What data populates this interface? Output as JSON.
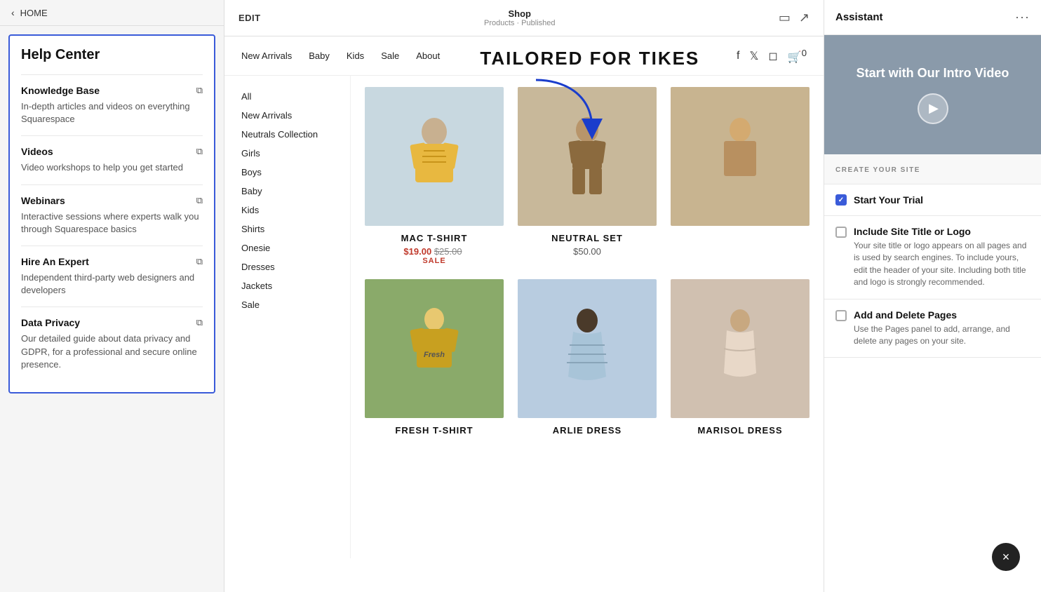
{
  "left_panel": {
    "back_label": "HOME",
    "title": "Help Center",
    "items": [
      {
        "id": "knowledge-base",
        "title": "Knowledge Base",
        "desc": "In-depth articles and videos on everything Squarespace"
      },
      {
        "id": "videos",
        "title": "Videos",
        "desc": "Video workshops to help you get started"
      },
      {
        "id": "webinars",
        "title": "Webinars",
        "desc": "Interactive sessions where experts walk you through Squarespace basics"
      },
      {
        "id": "hire-expert",
        "title": "Hire An Expert",
        "desc": "Independent third-party web designers and developers"
      },
      {
        "id": "data-privacy",
        "title": "Data Privacy",
        "desc": "Our detailed guide about data privacy and GDPR, for a professional and secure online presence."
      }
    ]
  },
  "editor_bar": {
    "edit_label": "EDIT",
    "shop_label": "Shop",
    "shop_sub": "Products · Published",
    "mobile_icon": "📱",
    "expand_icon": "↗"
  },
  "site_nav": {
    "links": [
      {
        "label": "New Arrivals"
      },
      {
        "label": "Baby"
      },
      {
        "label": "Kids"
      },
      {
        "label": "Sale"
      },
      {
        "label": "About"
      }
    ],
    "hero_title": "TAILORED FOR TIKES",
    "cart_count": "0"
  },
  "categories": [
    {
      "label": "All"
    },
    {
      "label": "New Arrivals"
    },
    {
      "label": "Neutrals Collection"
    },
    {
      "label": "Girls"
    },
    {
      "label": "Boys"
    },
    {
      "label": "Baby"
    },
    {
      "label": "Kids"
    },
    {
      "label": "Shirts"
    },
    {
      "label": "Onesie"
    },
    {
      "label": "Dresses"
    },
    {
      "label": "Jackets"
    },
    {
      "label": "Sale"
    }
  ],
  "products": [
    {
      "id": "mac-tshirt",
      "name": "MAC T-SHIRT",
      "price_original": "$25.00",
      "price_sale": "$19.00",
      "is_sale": true,
      "color_class": "yellow-bg"
    },
    {
      "id": "neutral-set",
      "name": "NEUTRAL SET",
      "price": "$50.00",
      "is_sale": false,
      "color_class": "tan-bg"
    },
    {
      "id": "placeholder3",
      "name": "",
      "price": "",
      "is_sale": false,
      "color_class": "beige-bg"
    },
    {
      "id": "fresh-tshirt",
      "name": "FRESH T-SHIRT",
      "price": "",
      "is_sale": false,
      "color_class": "green-bg"
    },
    {
      "id": "arlie-dress",
      "name": "ARLIE DRESS",
      "price": "",
      "is_sale": false,
      "color_class": "light-blue-bg"
    },
    {
      "id": "marisol-dress",
      "name": "MARISOL DRESS",
      "price": "",
      "is_sale": false,
      "color_class": "beige-bg"
    }
  ],
  "sale_label": "SALE",
  "assistant": {
    "title": "Assistant",
    "intro_video_label": "Start with Our Intro Video",
    "create_site_label": "CREATE YOUR SITE",
    "trial_label": "Start Your Trial",
    "checklist": [
      {
        "id": "include-title",
        "title": "Include Site Title or Logo",
        "desc": "Your site title or logo appears on all pages and is used by search engines. To include yours, edit the header of your site. Including both title and logo is strongly recommended."
      },
      {
        "id": "add-delete-pages",
        "title": "Add and Delete Pages",
        "desc": "Use the Pages panel to add, arrange, and delete any pages on your site."
      }
    ]
  },
  "close_btn": "×"
}
